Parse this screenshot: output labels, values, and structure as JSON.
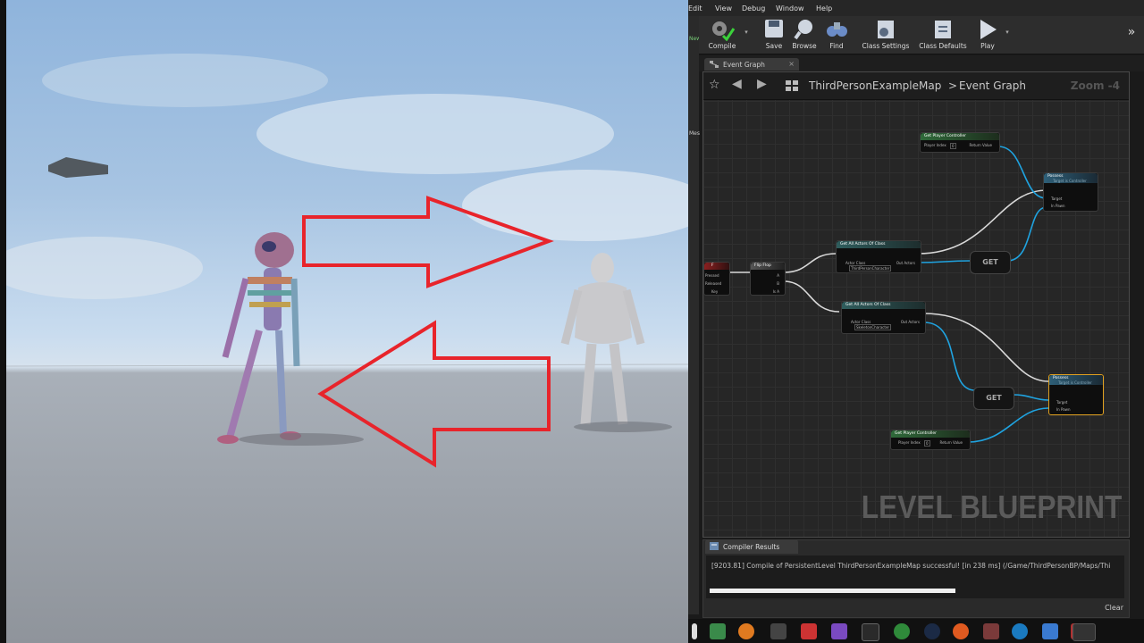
{
  "menu": [
    "Edit",
    "View",
    "Debug",
    "Window",
    "Help"
  ],
  "toolbar": {
    "compile": "Compile",
    "save": "Save",
    "browse": "Browse",
    "find": "Find",
    "class_settings": "Class Settings",
    "class_defaults": "Class Defaults",
    "play": "Play",
    "more": "»"
  },
  "side_tags": [
    "New",
    "Mes"
  ],
  "tab": {
    "label": "Event Graph",
    "close": "×"
  },
  "breadcrumb": {
    "map": "ThirdPersonExampleMap",
    "separator": ">",
    "graph": "Event Graph"
  },
  "zoom": "Zoom -4",
  "watermark": "LEVEL BLUEPRINT",
  "nodes": {
    "get_pc_top": {
      "title": "Get Player Controller",
      "pin_in": "Player Index",
      "pin_val": "0",
      "pin_out": "Return Value"
    },
    "possess_top": {
      "title": "Possess",
      "sub": "Target is Controller",
      "pin_target": "Target",
      "pin_pawn": "In Pawn"
    },
    "input_key": {
      "title": "F",
      "pin_pressed": "Pressed",
      "pin_released": "Released",
      "pin_key": "Key"
    },
    "flipflop": {
      "title": "Flip Flop",
      "pin_a": "A",
      "pin_b": "B",
      "pin_isa": "Is A"
    },
    "get_all_1": {
      "title": "Get All Actors Of Class",
      "pin_class": "Actor Class",
      "class_val": "ThirdPersonCharacter",
      "pin_out": "Out Actors"
    },
    "get_all_2": {
      "title": "Get All Actors Of Class",
      "pin_class": "Actor Class",
      "class_val": "SkeletonCharacter",
      "pin_out": "Out Actors"
    },
    "get_1": {
      "label": "GET"
    },
    "get_2": {
      "label": "GET"
    },
    "possess_bottom": {
      "title": "Possess",
      "sub": "Target is Controller",
      "pin_target": "Target",
      "pin_pawn": "In Pawn"
    },
    "get_pc_bottom": {
      "title": "Get Player Controller",
      "pin_in": "Player Index",
      "pin_val": "0",
      "pin_out": "Return Value"
    }
  },
  "results": {
    "tab": "Compiler Results",
    "message": "[9203.81] Compile of PersistentLevel ThirdPersonExampleMap successful! [in 238 ms] (/Game/ThirdPersonBP/Maps/Thi",
    "progress": 0.6,
    "clear": "Clear"
  },
  "colors": {
    "arrow": "#e8242b",
    "wire_exec": "#d8d8d8",
    "wire_obj": "#1fa3e0",
    "selected": "#e0a020"
  }
}
